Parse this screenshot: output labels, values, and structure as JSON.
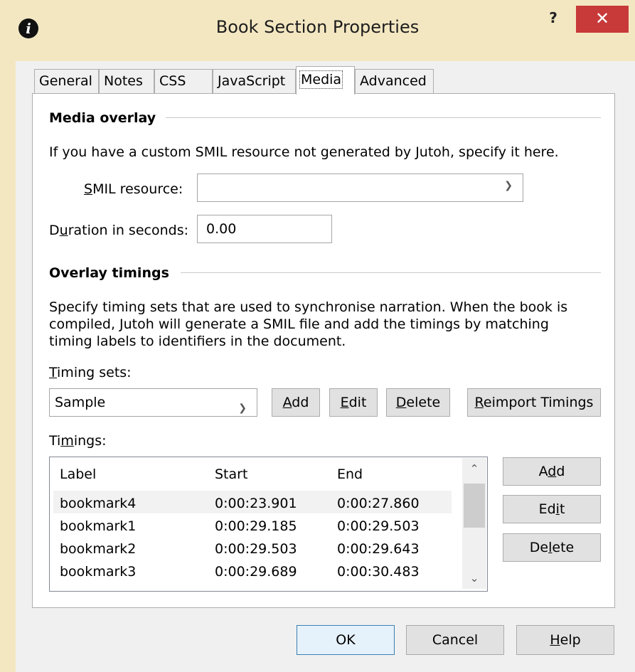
{
  "window": {
    "title": "Book Section Properties",
    "app_icon": "i",
    "help_label": "?",
    "close_label": "✕"
  },
  "tabs": [
    {
      "label": "General"
    },
    {
      "label": "Notes"
    },
    {
      "label": "CSS"
    },
    {
      "label": "JavaScript"
    },
    {
      "label": "Media",
      "active": true
    },
    {
      "label": "Advanced"
    }
  ],
  "media_overlay": {
    "heading": "Media overlay",
    "description": "If you have a custom SMIL resource not generated by Jutoh, specify it here.",
    "smil_label_pre": "",
    "smil_label_u": "S",
    "smil_label_post": "MIL resource:",
    "smil_value": "",
    "duration_label_pre": "D",
    "duration_label_u": "u",
    "duration_label_post": "ration in seconds:",
    "duration_value": "0.00"
  },
  "overlay_timings": {
    "heading": "Overlay timings",
    "description": "Specify timing sets that are used to synchronise narration. When the book is compiled, Jutoh will generate a SMIL file and add the timings by matching timing labels to identifiers in the document.",
    "timing_sets_u": "T",
    "timing_sets_post": "iming sets:",
    "timing_set_value": "Sample",
    "add_u": "A",
    "add_post": "dd",
    "edit_u": "E",
    "edit_post": "dit",
    "delete_u": "D",
    "delete_post": "elete",
    "reimport_u": "R",
    "reimport_post": "eimport Timings",
    "timings_pre": "Ti",
    "timings_u": "m",
    "timings_post": "ings:",
    "columns": {
      "label": "Label",
      "start": "Start",
      "end": "End"
    },
    "rows": [
      {
        "label": "bookmark4",
        "start": "0:00:23.901",
        "end": "0:00:27.860"
      },
      {
        "label": "bookmark1",
        "start": "0:00:29.185",
        "end": "0:00:29.503"
      },
      {
        "label": "bookmark2",
        "start": "0:00:29.503",
        "end": "0:00:29.643"
      },
      {
        "label": "bookmark3",
        "start": "0:00:29.689",
        "end": "0:00:30.483"
      }
    ],
    "side_add_pre": "A",
    "side_add_u": "d",
    "side_add_post": "d",
    "side_edit_pre": "Ed",
    "side_edit_u": "i",
    "side_edit_post": "t",
    "side_delete_pre": "De",
    "side_delete_u": "l",
    "side_delete_post": "ete"
  },
  "footer": {
    "ok": "OK",
    "cancel": "Cancel",
    "help_u": "H",
    "help_post": "elp"
  },
  "colors": {
    "titlebar": "#f3e7c2",
    "close": "#c83a3a",
    "panel": "#ffffff",
    "button": "#e1e1e1"
  }
}
